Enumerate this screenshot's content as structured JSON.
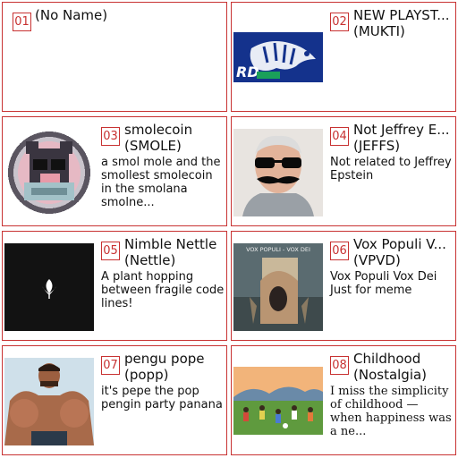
{
  "cards": [
    {
      "number": "01",
      "title": "(No Name)",
      "ticker": "",
      "description": "",
      "image": "none"
    },
    {
      "number": "02",
      "title": "NEW PLAYST...",
      "ticker": "(MUKTI)",
      "description": "",
      "image": "blue-tiger-logo"
    },
    {
      "number": "03",
      "title": "smolecoin",
      "ticker": "(SMOLE)",
      "description": "a smol mole and the smollest smolecoin in the smolana smolne...",
      "image": "pixel-mole-coin"
    },
    {
      "number": "04",
      "title": "Not Jeffrey E...",
      "ticker": "(JEFFS)",
      "description": "Not related to Jeffrey Epstein",
      "image": "man-sunglasses-mustache"
    },
    {
      "number": "05",
      "title": "Nimble Nettle",
      "ticker": "(Nettle)",
      "description": "A plant hopping between fragile code lines!",
      "image": "leaf-on-dark"
    },
    {
      "number": "06",
      "title": "Vox Populi V...",
      "ticker": "(VPVD)",
      "description": "Vox Populi Vox Dei Just for meme",
      "image": "vox-populi-poster",
      "image_caption": "VOX POPULI - VOX DEI"
    },
    {
      "number": "07",
      "title": "pengu pope",
      "ticker": "(popp)",
      "description": "it's pepe the pop pengin party panana",
      "image": "muscle-man"
    },
    {
      "number": "08",
      "title": "Childhood",
      "ticker": "(Nostalgia)",
      "description": "I miss the simplicity of childhood — when happiness was a ne...",
      "image": "kids-playing-field"
    }
  ]
}
